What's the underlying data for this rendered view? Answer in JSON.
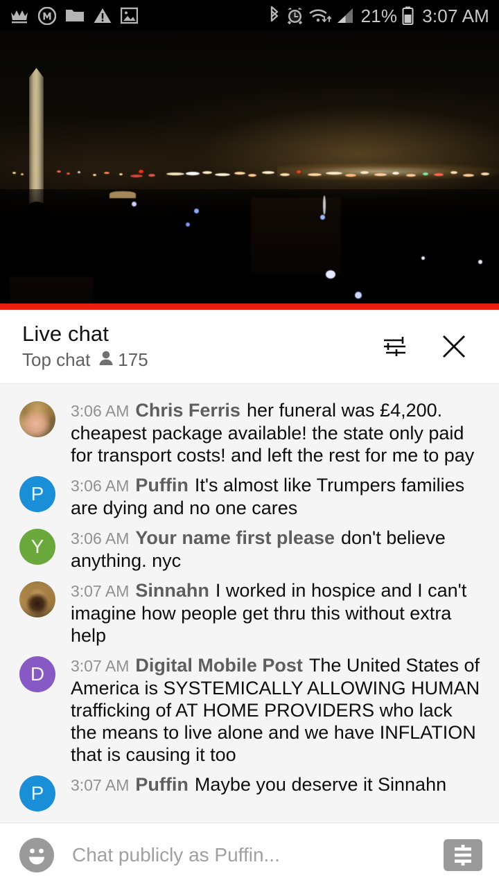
{
  "status_bar": {
    "left_icons": [
      "crown-icon",
      "m-badge-icon",
      "folder-icon",
      "warning-triangle-icon",
      "image-icon"
    ],
    "right_icons": [
      "bluetooth-icon",
      "alarm-clock-icon",
      "wifi-icon",
      "cellular-signal-icon",
      "battery-icon"
    ],
    "battery_percent": "21%",
    "clock": "3:07 AM"
  },
  "video": {
    "description": "Washington Monument night skyline live stream",
    "progress_percent": 100,
    "progress_color": "#e81e0e"
  },
  "chat_header": {
    "title": "Live chat",
    "mode": "Top chat",
    "viewer_count": "175",
    "viewer_icon": "person-icon",
    "settings_icon": "tune-sliders-icon",
    "close_icon": "close-x-icon"
  },
  "messages": [
    {
      "time": "3:06 AM",
      "author": "Chris Ferris",
      "text": "her funeral was £4,200. cheapest package available! the state only paid for transport costs! and left the rest for me to pay",
      "avatar_type": "photo",
      "avatar_photo": "child",
      "avatar_initial": "",
      "avatar_color": "#b89a63"
    },
    {
      "time": "3:06 AM",
      "author": "Puffin",
      "text": "It's almost like Trumpers families are dying and no one cares",
      "avatar_type": "initial",
      "avatar_photo": "",
      "avatar_initial": "P",
      "avatar_color": "#1a8fd8"
    },
    {
      "time": "3:06 AM",
      "author": "Your name first please",
      "text": "don't believe anything. nyc",
      "avatar_type": "initial",
      "avatar_photo": "",
      "avatar_initial": "Y",
      "avatar_color": "#6aa83c"
    },
    {
      "time": "3:07 AM",
      "author": "Sinnahn",
      "text": "I worked in hospice and I can't imagine how people get thru this without extra help",
      "avatar_type": "photo",
      "avatar_photo": "lion",
      "avatar_initial": "",
      "avatar_color": "#a67f47"
    },
    {
      "time": "3:07 AM",
      "author": "Digital Mobile Post",
      "text": "The United States of America is SYSTEMICALLY ALLOWING HUMAN trafficking of AT HOME PROVIDERS who lack the means to live alone and we have INFLATION that is causing it too",
      "avatar_type": "initial",
      "avatar_photo": "",
      "avatar_initial": "D",
      "avatar_color": "#8659c5"
    },
    {
      "time": "3:07 AM",
      "author": "Puffin",
      "text": "Maybe you deserve it Sinnahn",
      "avatar_type": "initial",
      "avatar_photo": "",
      "avatar_initial": "P",
      "avatar_color": "#1a8fd8"
    }
  ],
  "input_bar": {
    "emoji_icon": "smiley-face-icon",
    "placeholder": "Chat publicly as Puffin...",
    "value": "",
    "super_chat_icon": "dollar-ticket-icon"
  }
}
